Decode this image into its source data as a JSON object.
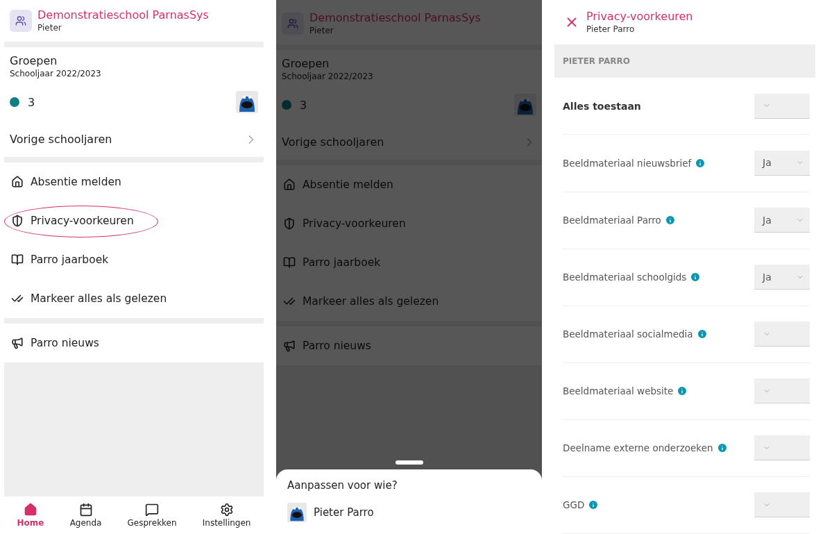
{
  "home_screen": {
    "header": {
      "title": "Demonstratieschool ParnasSys",
      "subtitle": "Pieter"
    },
    "groups": {
      "title": "Groepen",
      "subtitle": "Schooljaar 2022/2023",
      "group_label": "3",
      "previous": "Vorige schooljaren"
    },
    "menu_sections": [
      [
        {
          "label": "Absentie melden",
          "highlighted": false
        },
        {
          "label": "Privacy-voorkeuren",
          "highlighted": true
        },
        {
          "label": "Parro jaarboek",
          "highlighted": false
        },
        {
          "label": "Markeer alles als gelezen",
          "highlighted": false
        }
      ],
      [
        {
          "label": "Parro nieuws",
          "highlighted": false
        }
      ]
    ],
    "tabs": [
      {
        "label": "Home",
        "selected": true
      },
      {
        "label": "Agenda",
        "selected": false
      },
      {
        "label": "Gesprekken",
        "selected": false
      },
      {
        "label": "Instellingen",
        "selected": false
      }
    ]
  },
  "dimmed_screen": {
    "header": {
      "title": "Demonstratieschool ParnasSys",
      "subtitle": "Pieter"
    },
    "groups": {
      "title": "Groepen",
      "subtitle": "Schooljaar 2022/2023",
      "group_label": "3",
      "previous": "Vorige schooljaren"
    },
    "menu_sections": [
      [
        {
          "label": "Absentie melden",
          "highlighted": false
        },
        {
          "label": "Privacy-voorkeuren",
          "highlighted": false
        },
        {
          "label": "Parro jaarboek",
          "highlighted": false
        },
        {
          "label": "Markeer alles als gelezen",
          "highlighted": false
        }
      ],
      [
        {
          "label": "Parro nieuws",
          "highlighted": false
        }
      ]
    ],
    "sheet": {
      "title": "Aanpassen voor wie?",
      "people": [
        {
          "name": "Pieter Parro"
        }
      ]
    }
  },
  "privacy_screen": {
    "title": "Privacy-voorkeuren",
    "subtitle": "Pieter Parro",
    "section": "PIETER PARRO",
    "settings": [
      {
        "kind": "master",
        "label": "Alles toestaan"
      },
      {
        "kind": "setting",
        "label": "Beeldmateriaal nieuwsbrief",
        "value": "Ja"
      },
      {
        "kind": "setting",
        "label": "Beeldmateriaal Parro",
        "value": "Ja"
      },
      {
        "kind": "setting",
        "label": "Beeldmateriaal schoolgids",
        "value": "Ja"
      },
      {
        "kind": "setting",
        "label": "Beeldmateriaal socialmedia"
      },
      {
        "kind": "setting",
        "label": "Beeldmateriaal website"
      },
      {
        "kind": "setting",
        "label": "Deelname externe onderzoeken"
      },
      {
        "kind": "setting",
        "label": "GGD"
      }
    ]
  }
}
